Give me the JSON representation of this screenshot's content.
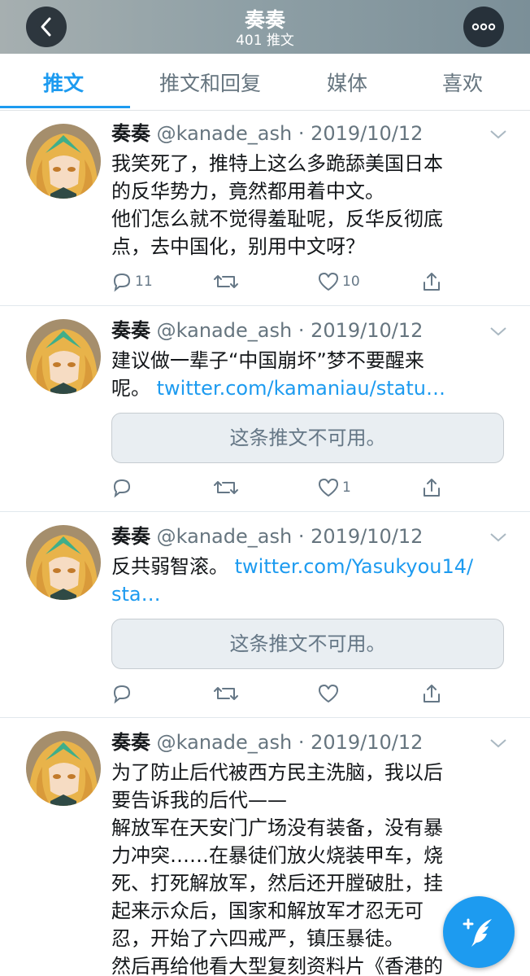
{
  "header": {
    "title": "奏奏",
    "subtitle": "401 推文"
  },
  "tabs": [
    {
      "label": "推文",
      "active": true
    },
    {
      "label": "推文和回复",
      "active": false
    },
    {
      "label": "媒体",
      "active": false
    },
    {
      "label": "喜欢",
      "active": false
    }
  ],
  "tweets": [
    {
      "name": "奏奏",
      "handle": "@kanade_ash",
      "date": "· 2019/10/12",
      "lines": [
        "我笑死了，推特上这么多跪舔美国日本",
        "的反华势力，竟然都用着中文。",
        "他们怎么就不觉得羞耻呢，反华反彻底",
        "点，去中国化，别用中文呀？"
      ],
      "replies": "11",
      "likes": "10"
    },
    {
      "name": "奏奏",
      "handle": "@kanade_ash",
      "date": "· 2019/10/12",
      "line1": "建议做一辈子“中国崩坏”梦不要醒来",
      "line2_text": "呢。",
      "line2_link": "twitter.com/kamaniau/statu…",
      "unavailable": "这条推文不可用。",
      "likes": "1"
    },
    {
      "name": "奏奏",
      "handle": "@kanade_ash",
      "date": "· 2019/10/12",
      "line1_text": "反共弱智滚。",
      "line1_link": "twitter.com/Yasukyou14/",
      "line2_link": "sta…",
      "unavailable": "这条推文不可用。"
    },
    {
      "name": "奏奏",
      "handle": "@kanade_ash",
      "date": "· 2019/10/12",
      "lines": [
        "为了防止后代被西方民主洗脑，我以后",
        "要告诉我的后代——",
        "解放军在天安门广场没有装备，没有暴",
        "力冲突……在暴徒们放火烧装甲车，烧",
        "死、打死解放军，然后还开膛破肚，挂",
        "起来示众后，国家和解放军才忍无可",
        "忍，开始了六四戒严，镇压暴徒。",
        "然后再给他看大型复刻资料片《香港的"
      ]
    }
  ],
  "colors": {
    "accent": "#1d9bf0",
    "secondary_text": "#657786",
    "header_bg": "#8fa0a6"
  },
  "icons": {
    "back": "chevron-left-icon",
    "more": "more-dots-icon",
    "reply": "reply-icon",
    "retweet": "retweet-icon",
    "like": "heart-icon",
    "share": "share-icon",
    "compose": "compose-tweet-icon"
  }
}
